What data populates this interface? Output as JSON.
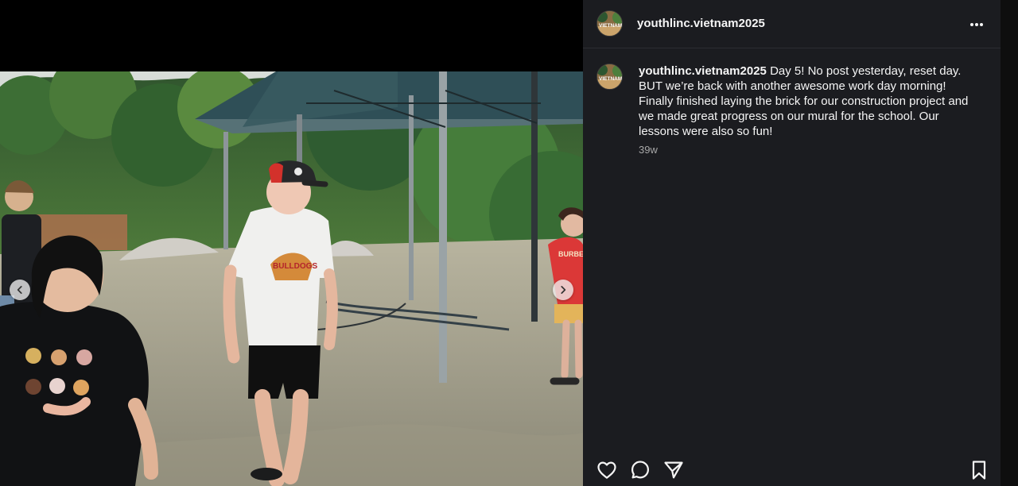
{
  "post": {
    "username": "youthlinc.vietnam2025",
    "caption_username": "youthlinc.vietnam2025",
    "caption_text": " Day 5! No post yesterday, reset day. BUT we’re back with another awesome work day morning! Finally finished laying the brick for our construction project and we made great progress on our mural for the school. Our lessons were also so fun!",
    "timestamp": "39w"
  },
  "avatar": {
    "text": "VIETNAM"
  },
  "photo_text": {
    "shirt_text": "BULLDOGS",
    "shirt_text_2": "BURBERRY"
  },
  "icons": {
    "more": "more-icon",
    "like": "heart-icon",
    "comment": "comment-icon",
    "share": "paper-plane-icon",
    "save": "bookmark-icon",
    "prev": "chevron-left-icon",
    "next": "chevron-right-icon"
  },
  "colors": {
    "panel": "#1b1c20",
    "text": "#f5f5f5",
    "muted": "#a8a8a8"
  }
}
